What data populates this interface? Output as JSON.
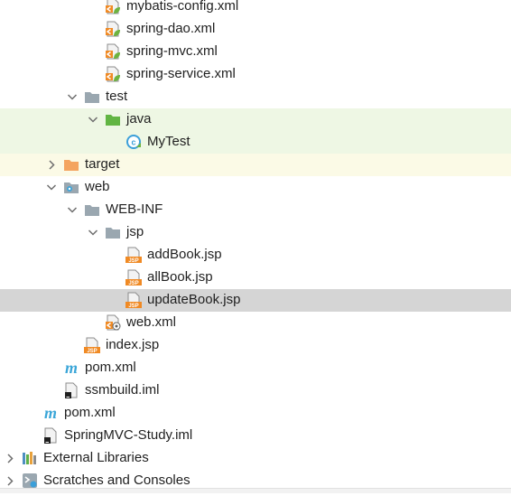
{
  "tree": {
    "nodes": [
      {
        "id": "mybatis-config",
        "label": "mybatis-config.xml",
        "depth": 4,
        "icon": "spring-xml-icon",
        "expand": "none"
      },
      {
        "id": "spring-dao",
        "label": "spring-dao.xml",
        "depth": 4,
        "icon": "spring-xml-icon",
        "expand": "none"
      },
      {
        "id": "spring-mvc",
        "label": "spring-mvc.xml",
        "depth": 4,
        "icon": "spring-xml-icon",
        "expand": "none"
      },
      {
        "id": "spring-service",
        "label": "spring-service.xml",
        "depth": 4,
        "icon": "spring-xml-icon",
        "expand": "none"
      },
      {
        "id": "test",
        "label": "test",
        "depth": 3,
        "icon": "folder-icon",
        "expand": "expanded"
      },
      {
        "id": "java",
        "label": "java",
        "depth": 4,
        "icon": "test-source-folder-icon",
        "expand": "expanded",
        "highlight": "test"
      },
      {
        "id": "mytest",
        "label": "MyTest",
        "depth": 5,
        "icon": "java-class-icon",
        "expand": "none",
        "highlight": "test"
      },
      {
        "id": "target",
        "label": "target",
        "depth": 2,
        "icon": "excluded-folder-icon",
        "expand": "collapsed",
        "highlight": "target"
      },
      {
        "id": "web",
        "label": "web",
        "depth": 2,
        "icon": "web-folder-icon",
        "expand": "expanded"
      },
      {
        "id": "web-inf",
        "label": "WEB-INF",
        "depth": 3,
        "icon": "folder-icon",
        "expand": "expanded"
      },
      {
        "id": "jsp",
        "label": "jsp",
        "depth": 4,
        "icon": "folder-icon",
        "expand": "expanded"
      },
      {
        "id": "addbook",
        "label": "addBook.jsp",
        "depth": 5,
        "icon": "jsp-file-icon",
        "expand": "none"
      },
      {
        "id": "allbook",
        "label": "allBook.jsp",
        "depth": 5,
        "icon": "jsp-file-icon",
        "expand": "none"
      },
      {
        "id": "updatebook",
        "label": "updateBook.jsp",
        "depth": 5,
        "icon": "jsp-file-icon",
        "expand": "none",
        "selected": true
      },
      {
        "id": "webxml",
        "label": "web.xml",
        "depth": 4,
        "icon": "web-xml-icon",
        "expand": "none"
      },
      {
        "id": "index",
        "label": "index.jsp",
        "depth": 3,
        "icon": "jsp-file-icon",
        "expand": "none"
      },
      {
        "id": "pom-module",
        "label": "pom.xml",
        "depth": 2,
        "icon": "maven-icon",
        "expand": "none"
      },
      {
        "id": "ssmbuild-iml",
        "label": "ssmbuild.iml",
        "depth": 2,
        "icon": "iml-file-icon",
        "expand": "none"
      },
      {
        "id": "pom-root",
        "label": "pom.xml",
        "depth": 1,
        "icon": "maven-icon",
        "expand": "none"
      },
      {
        "id": "springmvc-iml",
        "label": "SpringMVC-Study.iml",
        "depth": 1,
        "icon": "iml-file-icon",
        "expand": "none"
      },
      {
        "id": "external-libraries",
        "label": "External Libraries",
        "depth": 0,
        "icon": "library-icon",
        "expand": "collapsed"
      },
      {
        "id": "scratches",
        "label": "Scratches and Consoles",
        "depth": 0,
        "icon": "scratches-icon",
        "expand": "collapsed"
      }
    ]
  },
  "colors": {
    "test_row_bg": "#eef7e4",
    "target_row_bg": "#fbfae6",
    "selected_row_bg": "#d5d5d5",
    "folder": "#9aa7b0",
    "test_folder": "#62b543",
    "excluded_folder": "#f4a460",
    "jsp_orange": "#f08a24",
    "spring_green": "#6db33f",
    "maven_blue": "#3ba6d8"
  }
}
